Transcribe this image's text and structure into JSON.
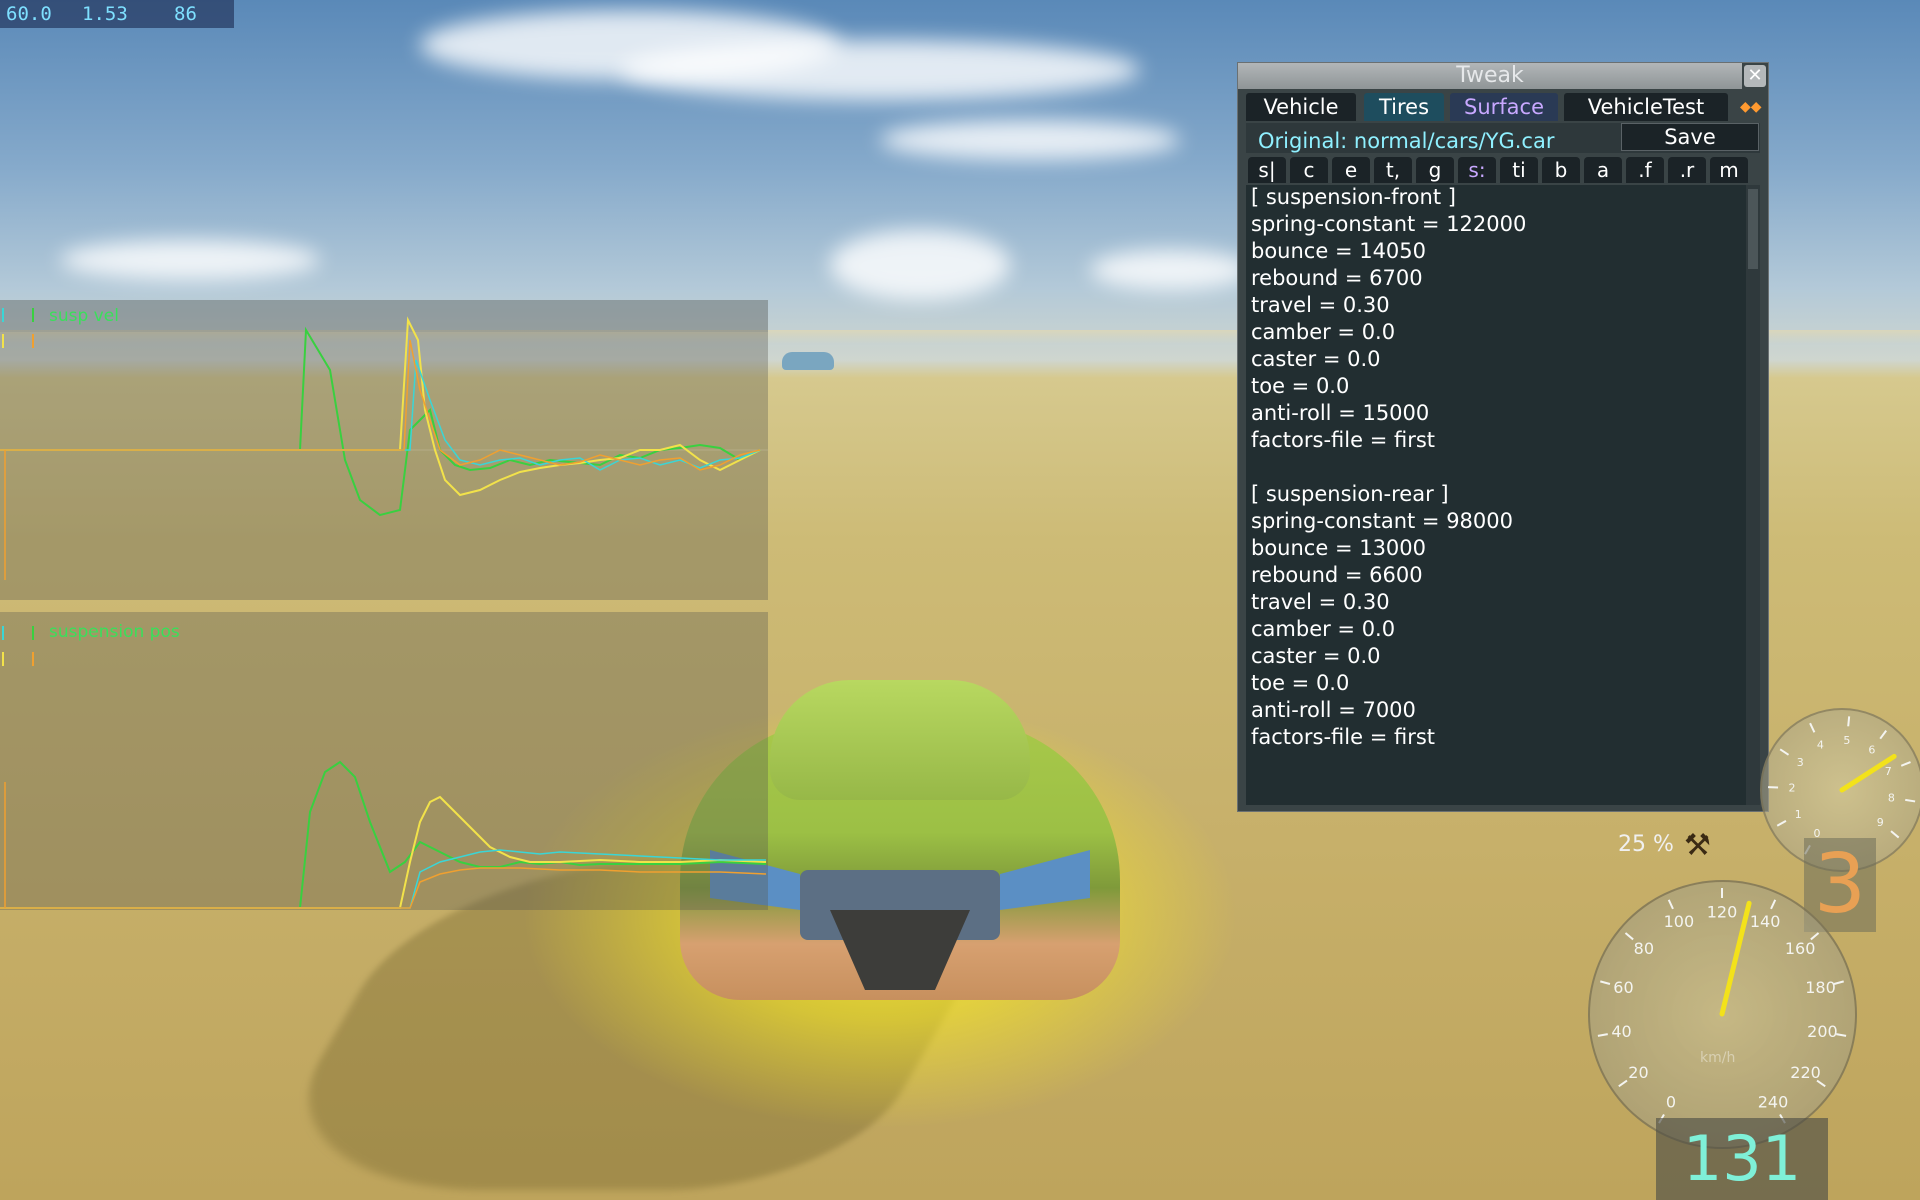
{
  "fps": {
    "fps": "60.0",
    "frame_ms": "1.53",
    "third": "86"
  },
  "graphs": [
    {
      "title": "susp vel"
    },
    {
      "title": "suspension pos"
    }
  ],
  "tweak": {
    "title": "Tweak",
    "close": "✕",
    "tabs": [
      "Vehicle",
      "Tires",
      "Surface",
      "VehicleTest"
    ],
    "original": "Original: normal/cars/YG.car",
    "save": "Save",
    "chips": [
      "s|",
      "c",
      "e",
      "t,",
      "g",
      "s:",
      "ti",
      "b",
      "a",
      ".f",
      ".r",
      "m"
    ],
    "lines": [
      "[ suspension-front ]",
      "spring-constant = 122000",
      "bounce = 14050",
      "rebound = 6700",
      "travel = 0.30",
      "camber = 0.0",
      "caster = 0.0",
      "toe = 0.0",
      "anti-roll = 15000",
      "factors-file = first",
      "",
      "[ suspension-rear ]",
      "spring-constant = 98000",
      "bounce = 13000",
      "rebound = 6600",
      "travel = 0.30",
      "camber = 0.0",
      "caster = 0.0",
      "toe = 0.0",
      "anti-roll = 7000",
      "factors-file = first"
    ]
  },
  "hud": {
    "damage": "25 %",
    "gear": "3",
    "speed": "131",
    "speed_unit": "km/h",
    "tach_ticks": [
      "0",
      "1",
      "2",
      "3",
      "4",
      "5",
      "6",
      "7",
      "8",
      "9"
    ],
    "speedo_ticks": [
      "0",
      "20",
      "40",
      "60",
      "80",
      "100",
      "120",
      "140",
      "160",
      "180",
      "200",
      "220",
      "240"
    ],
    "colors": {
      "speed_needle": "#f3e21a",
      "graph_green": "#39d040",
      "graph_yellow": "#f2e24a",
      "graph_cyan": "#3ad6d6",
      "graph_orange": "#f0a030"
    }
  }
}
